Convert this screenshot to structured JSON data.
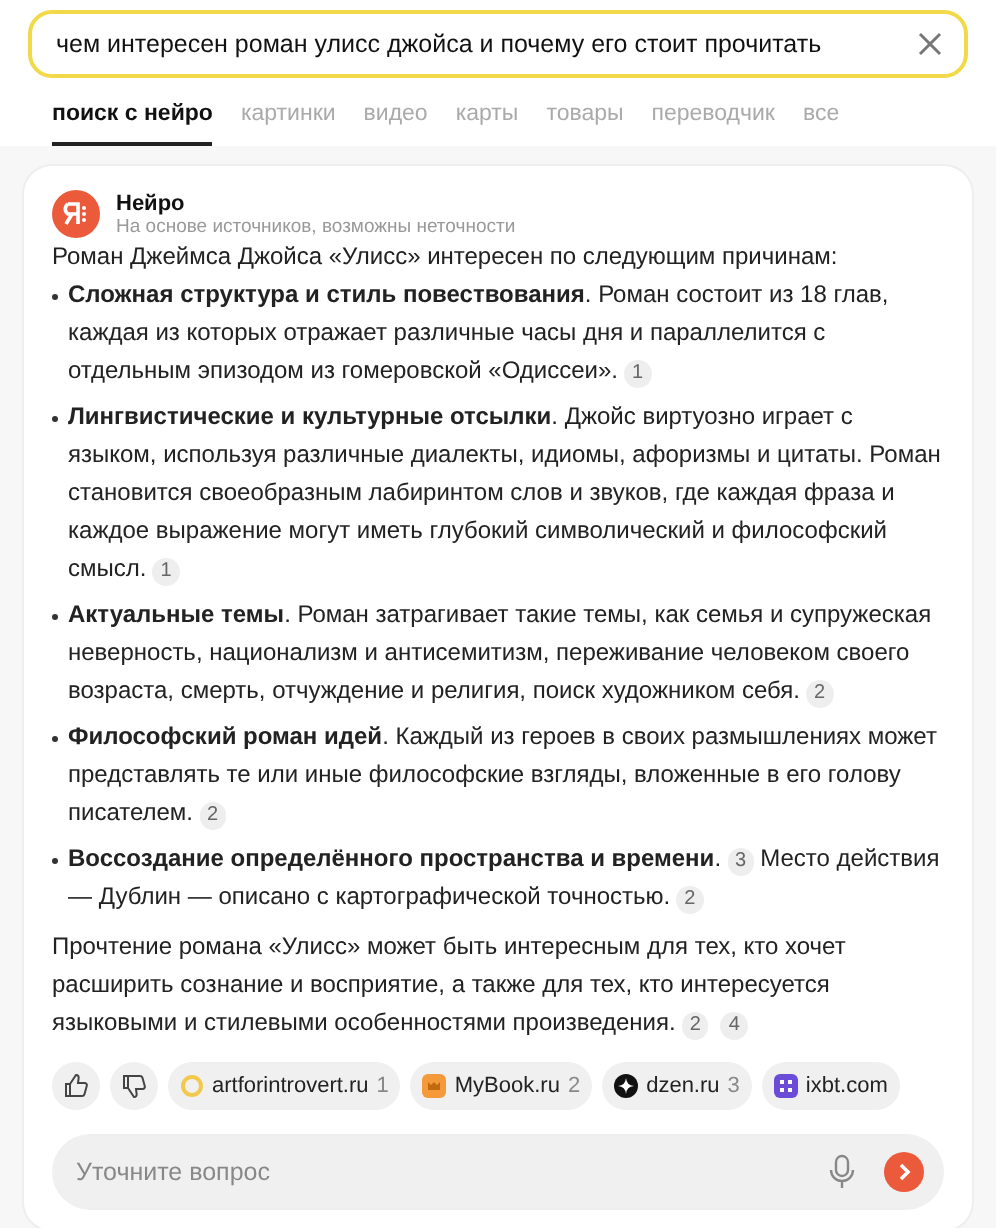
{
  "search": {
    "value": "чем интересен роман улисс джойса и почему его стоит прочитать"
  },
  "tabs": [
    {
      "label": "поиск с нейро",
      "selected": true
    },
    {
      "label": "картинки",
      "selected": false
    },
    {
      "label": "видео",
      "selected": false
    },
    {
      "label": "карты",
      "selected": false
    },
    {
      "label": "товары",
      "selected": false
    },
    {
      "label": "переводчик",
      "selected": false
    },
    {
      "label": "все",
      "selected": false
    }
  ],
  "answer": {
    "source_name": "Нейро",
    "disclaimer": "На основе источников, возможны неточности",
    "intro": "Роман Джеймса Джойса «Улисс» интересен по следующим причинам:",
    "items": [
      {
        "parts": [
          {
            "kind": "bold",
            "text": "Сложная структура и стиль повествования"
          },
          {
            "kind": "text",
            "text": ". Роман состоит из 18 глав, каждая из которых отражает различные часы дня и параллелится с отдельным эпизодом из гомеровской «Одиссеи»."
          },
          {
            "kind": "ref",
            "text": "1"
          }
        ]
      },
      {
        "parts": [
          {
            "kind": "bold",
            "text": "Лингвистические и культурные отсылки"
          },
          {
            "kind": "text",
            "text": ". Джойс виртуозно играет с языком, используя различные диалекты, идиомы, афоризмы и цитаты. Роман становится своеобразным лабиринтом слов и звуков, где каждая фраза и каждое выражение могут иметь глубокий символический и философский смысл."
          },
          {
            "kind": "ref",
            "text": "1"
          }
        ]
      },
      {
        "parts": [
          {
            "kind": "bold",
            "text": "Актуальные темы"
          },
          {
            "kind": "text",
            "text": ". Роман затрагивает такие темы, как семья и супружеская неверность, национализм и антисемитизм, переживание человеком своего возраста, смерть, отчуждение и религия, поиск художником себя."
          },
          {
            "kind": "ref",
            "text": "2"
          }
        ]
      },
      {
        "parts": [
          {
            "kind": "bold",
            "text": "Философский роман идей"
          },
          {
            "kind": "text",
            "text": ". Каждый из героев в своих размышлениях может представлять те или иные философские взгляды, вложенные в его голову писателем."
          },
          {
            "kind": "ref",
            "text": "2"
          }
        ]
      },
      {
        "parts": [
          {
            "kind": "bold",
            "text": "Воссоздание определённого пространства и времени"
          },
          {
            "kind": "text",
            "text": "."
          },
          {
            "kind": "ref",
            "text": "3"
          },
          {
            "kind": "text",
            "text": "Место действия — Дублин — описано с картографической точностью."
          },
          {
            "kind": "ref",
            "text": "2"
          }
        ]
      }
    ],
    "conclusion": [
      {
        "kind": "text",
        "text": "Прочтение романа «Улисс» может быть интересным для тех, кто хочет расширить сознание и восприятие, а также для тех, кто интересуется языковыми и стилевыми особенностями произведения."
      },
      {
        "kind": "ref",
        "text": "2"
      },
      {
        "kind": "ref",
        "text": "4"
      }
    ],
    "sources": [
      {
        "name": "artforintrovert.ru",
        "number": "1",
        "kind": "ring"
      },
      {
        "name": "MyBook.ru",
        "number": "2",
        "kind": "book"
      },
      {
        "name": "dzen.ru",
        "number": "3",
        "kind": "dzen"
      },
      {
        "name": "ixbt.com",
        "kind": "ixbt"
      }
    ]
  },
  "ask": {
    "placeholder": "Уточните вопрос"
  }
}
